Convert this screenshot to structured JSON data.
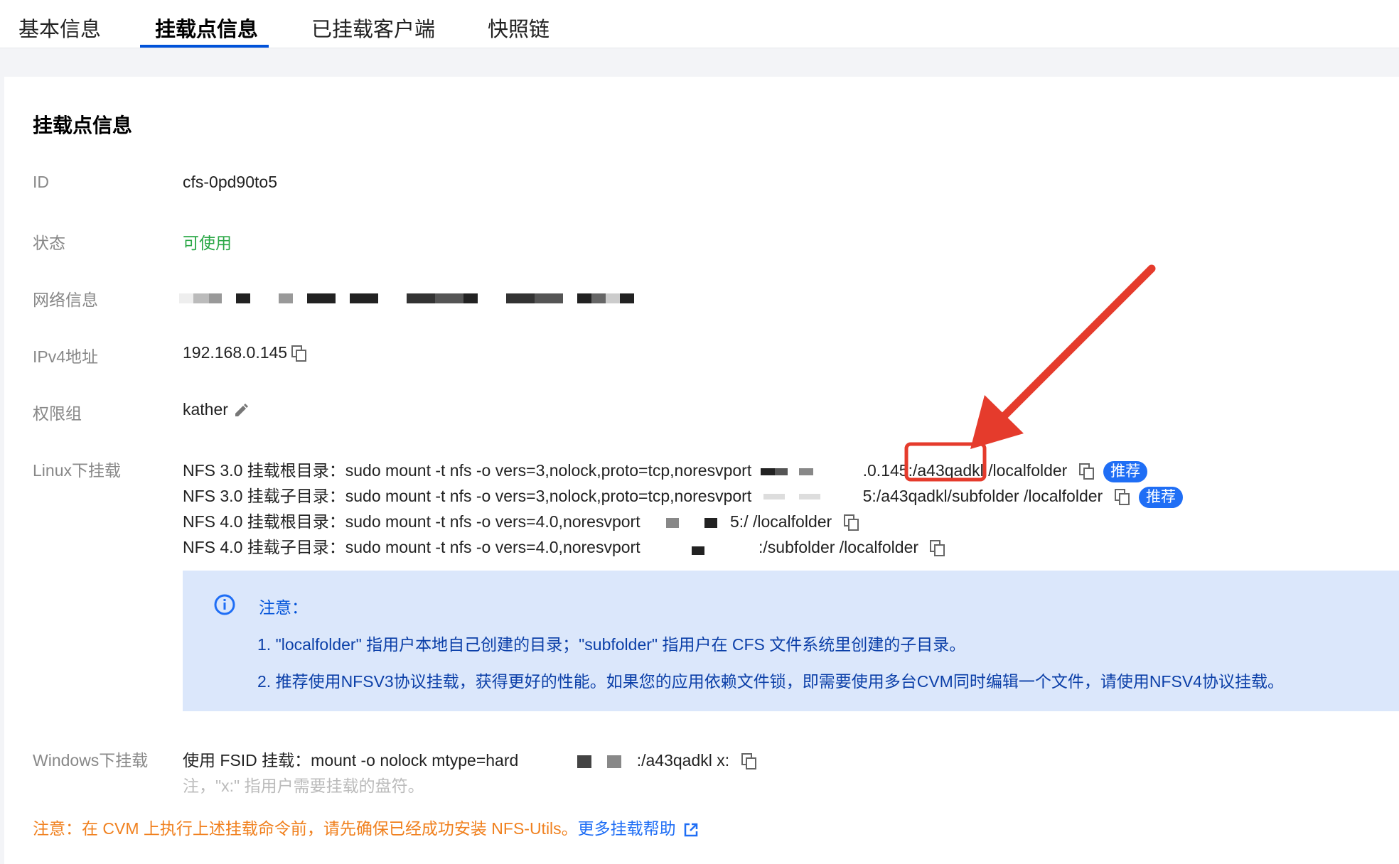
{
  "tabs": [
    {
      "label": "基本信息"
    },
    {
      "label": "挂载点信息"
    },
    {
      "label": "已挂载客户端"
    },
    {
      "label": "快照链"
    }
  ],
  "section_title": "挂载点信息",
  "fields": {
    "id": {
      "label": "ID",
      "value": "cfs-0pd90to5"
    },
    "status": {
      "label": "状态",
      "value": "可使用"
    },
    "network": {
      "label": "网络信息"
    },
    "ipv4": {
      "label": "IPv4地址",
      "value": "192.168.0.145"
    },
    "perm": {
      "label": "权限组",
      "value": "kather"
    },
    "linux": {
      "label": "Linux下挂载"
    },
    "windows": {
      "label": "Windows下挂载"
    }
  },
  "linux_cmds": [
    {
      "prefix": "NFS 3.0 挂载根目录：",
      "cmd": "sudo mount -t nfs -o vers=3,nolock,proto=tcp,noresvport",
      "host_tail": ".0.145:",
      "path": "/a43qadkl",
      "rest": " /localfolder",
      "badge": "推荐"
    },
    {
      "prefix": "NFS 3.0 挂载子目录：",
      "cmd": "sudo mount -t nfs -o vers=3,nolock,proto=tcp,noresvport",
      "host_tail": "5:",
      "path": "/a43qadkl/subfolder /localfolder",
      "badge": "推荐"
    },
    {
      "prefix": "NFS 4.0 挂载根目录：",
      "cmd": "sudo mount -t nfs -o vers=4.0,noresvport",
      "host_tail": "5:",
      "path": "/ /localfolder"
    },
    {
      "prefix": "NFS 4.0 挂载子目录：",
      "cmd": "sudo mount -t nfs -o vers=4.0,noresvport",
      "host_tail": ":",
      "path": "/subfolder /localfolder"
    }
  ],
  "notice": {
    "title": "注意：",
    "line1": "1. \"localfolder\" 指用户本地自己创建的目录；\"subfolder\" 指用户在 CFS 文件系统里创建的子目录。",
    "line2": "2. 推荐使用NFSV3协议挂载，获得更好的性能。如果您的应用依赖文件锁，即需要使用多台CVM同时编辑一个文件，请使用NFSV4协议挂载。"
  },
  "windows_cmd": {
    "prefix": "使用 FSID 挂载：",
    "cmd": "mount -o nolock mtype=hard",
    "tail": ":/a43qadkl x:",
    "hint": "注，\"x:\" 指用户需要挂载的盘符。"
  },
  "warning": {
    "text": "注意：在 CVM 上执行上述挂载命令前，请先确保已经成功安装 NFS-Utils。",
    "link": "更多挂载帮助"
  },
  "colors": {
    "accent": "#0052d9",
    "status_ok": "#29a745",
    "badge": "#1f6ef5",
    "notice_bg": "#dbe7fb",
    "warning": "#f0801e",
    "annotation": "#e53b2c"
  }
}
